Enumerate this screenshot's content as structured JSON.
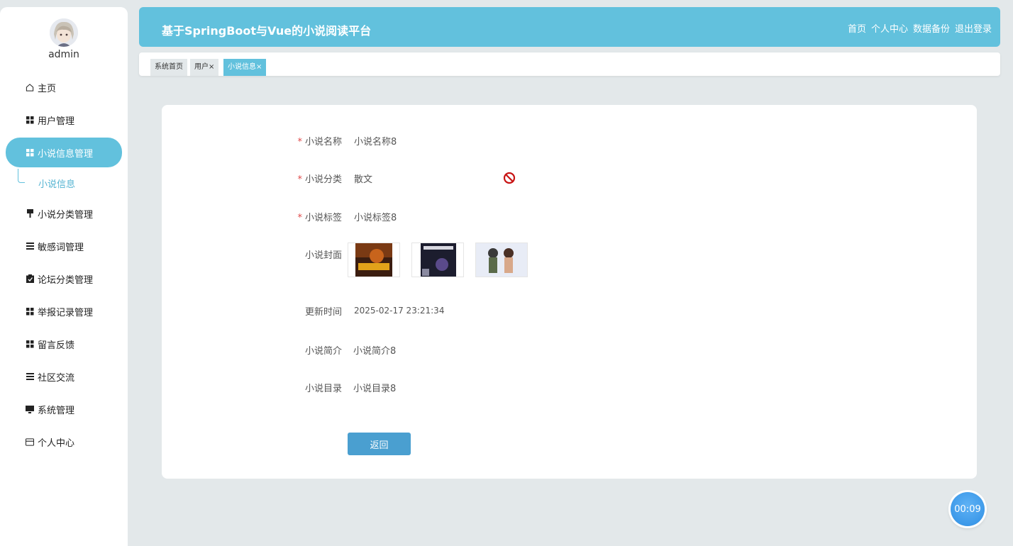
{
  "user": {
    "name": "admin"
  },
  "sidebar": {
    "items": [
      {
        "label": "主页",
        "icon": "home-icon"
      },
      {
        "label": "用户管理",
        "icon": "grid-icon"
      },
      {
        "label": "小说信息管理",
        "icon": "grid-icon",
        "active": true
      },
      {
        "label": "小说分类管理",
        "icon": "pin-icon"
      },
      {
        "label": "敏感词管理",
        "icon": "list-icon"
      },
      {
        "label": "论坛分类管理",
        "icon": "clipboard-icon"
      },
      {
        "label": "举报记录管理",
        "icon": "grid-icon"
      },
      {
        "label": "留言反馈",
        "icon": "grid-icon"
      },
      {
        "label": "社区交流",
        "icon": "list-icon"
      },
      {
        "label": "系统管理",
        "icon": "monitor-icon"
      },
      {
        "label": "个人中心",
        "icon": "card-icon"
      }
    ],
    "submenu": {
      "label": "小说信息"
    }
  },
  "header": {
    "title": "基于SpringBoot与Vue的小说阅读平台",
    "nav": [
      "首页",
      "个人中心",
      "数据备份",
      "退出登录"
    ]
  },
  "tags": [
    {
      "label": "系统首页"
    },
    {
      "label": "用户×"
    },
    {
      "label": "小说信息×",
      "active": true
    }
  ],
  "form": {
    "name_label": "小说名称",
    "name_value": "小说名称8",
    "category_label": "小说分类",
    "category_value": "散文",
    "tags_label": "小说标签",
    "tags_value": "小说标签8",
    "cover_label": "小说封面",
    "updated_label": "更新时间",
    "updated_value": "2025-02-17 23:21:34",
    "intro_label": "小说简介",
    "intro_value": "小说简介8",
    "toc_label": "小说目录",
    "toc_value": "小说目录8",
    "back_label": "返回",
    "required_mark": "*"
  },
  "timer": {
    "value": "00:09"
  },
  "colors": {
    "accent": "#62c1dd",
    "button": "#4a9fd0",
    "background": "#e3e8ea"
  }
}
